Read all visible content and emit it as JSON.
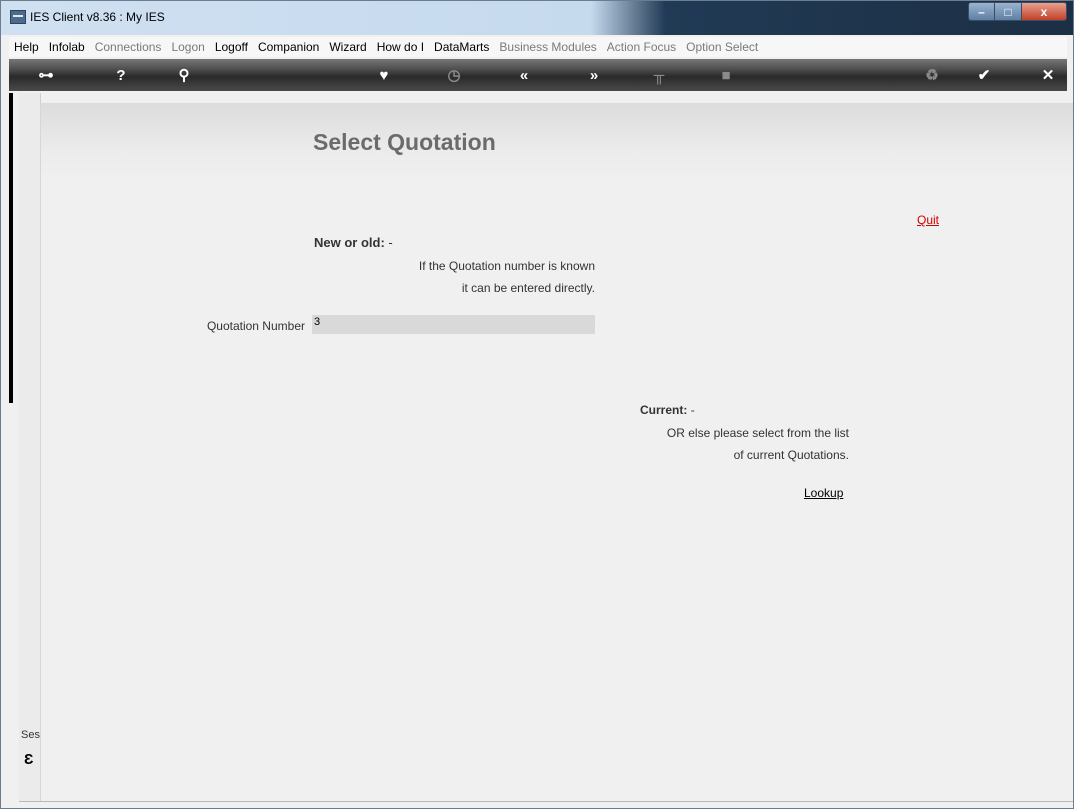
{
  "window": {
    "title": "IES Client v8.36 : My IES",
    "controls": {
      "minimize": "–",
      "maximize": "□",
      "close": "x"
    }
  },
  "menu": [
    {
      "label": "Help",
      "enabled": true
    },
    {
      "label": "Infolab",
      "enabled": true
    },
    {
      "label": "Connections",
      "enabled": false
    },
    {
      "label": "Logon",
      "enabled": false
    },
    {
      "label": "Logoff",
      "enabled": true
    },
    {
      "label": "Companion",
      "enabled": true
    },
    {
      "label": "Wizard",
      "enabled": true
    },
    {
      "label": "How do I",
      "enabled": true
    },
    {
      "label": "DataMarts",
      "enabled": true
    },
    {
      "label": "Business Modules",
      "enabled": false
    },
    {
      "label": "Action Focus",
      "enabled": false
    },
    {
      "label": "Option Select",
      "enabled": false
    }
  ],
  "toolbar": {
    "icons": [
      {
        "name": "key-icon",
        "glyph": "⊶"
      },
      {
        "name": "help-icon",
        "glyph": "?"
      },
      {
        "name": "search-icon",
        "glyph": "⚲"
      },
      {
        "name": "heart-icon",
        "glyph": "♥"
      },
      {
        "name": "clock-icon",
        "glyph": "◷"
      },
      {
        "name": "back-icon",
        "glyph": "«"
      },
      {
        "name": "forward-icon",
        "glyph": "»"
      },
      {
        "name": "tools-icon",
        "glyph": "╥"
      },
      {
        "name": "document-icon",
        "glyph": "■"
      },
      {
        "name": "recycle-icon",
        "glyph": "♻"
      },
      {
        "name": "check-icon",
        "glyph": "✔"
      },
      {
        "name": "close-icon",
        "glyph": "✕"
      }
    ]
  },
  "page": {
    "title": "Select Quotation",
    "quit_label": "Quit",
    "new_or_old": {
      "heading": "New or old:",
      "dash": "-",
      "help_line1": "If the Quotation number is known",
      "help_line2": "it can be entered directly."
    },
    "quotation_field": {
      "label": "Quotation Number",
      "value": "3"
    },
    "current": {
      "heading": "Current:",
      "dash": "-",
      "help_line1": "OR else please select from the list",
      "help_line2": "of current Quotations."
    },
    "lookup_label": "Lookup"
  },
  "session": {
    "label": "Ses",
    "icon_glyph": "Ɛ"
  }
}
